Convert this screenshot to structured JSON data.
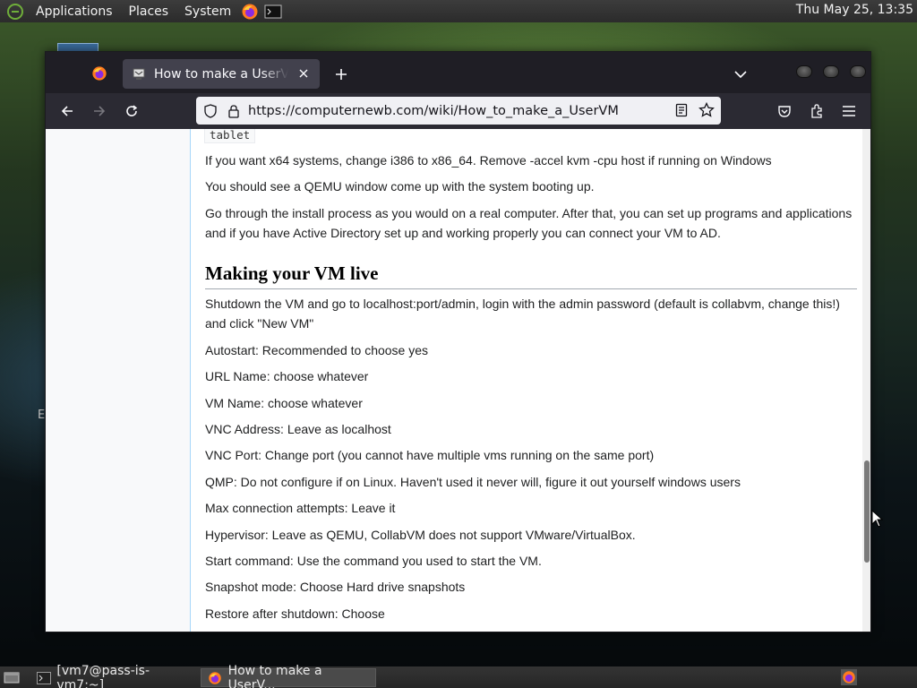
{
  "top_panel": {
    "menus": [
      "Applications",
      "Places",
      "System"
    ],
    "clock": "Thu May 25, 13:35"
  },
  "desktop": {
    "partial_label": "E"
  },
  "browser": {
    "tab": {
      "title": "How to make a UserVM - CollabVM Wiki"
    },
    "url": "https://computernewb.com/wiki/How_to_make_a_UserVM"
  },
  "page": {
    "code_fragment": "tablet",
    "paragraphs_top": [
      "If you want x64 systems, change i386 to x86_64. Remove -accel kvm -cpu host if running on Windows",
      "You should see a QEMU window come up with the system booting up.",
      "Go through the install process as you would on a real computer. After that, you can set up programs and applications and if you have Active Directory set up and working properly you can connect your VM to AD."
    ],
    "section_heading": "Making your VM live",
    "paragraphs_section": [
      "Shutdown the VM and go to localhost:port/admin, login with the admin password (default is collabvm, change this!) and click \"New VM\"",
      "Autostart: Recommended to choose yes",
      "URL Name: choose whatever",
      "VM Name: choose whatever",
      "VNC Address: Leave as localhost",
      "VNC Port: Change port (you cannot have multiple vms running on the same port)",
      "QMP: Do not configure if on Linux. Haven't used it never will, figure it out yourself windows users",
      "Max connection attempts: Leave it",
      "Hypervisor: Leave as QEMU, CollabVM does not support VMware/VirtualBox.",
      "Start command: Use the command you used to start the VM.",
      "Snapshot mode: Choose Hard drive snapshots",
      "Restore after shutdown: Choose"
    ]
  },
  "taskbar": {
    "tasks": [
      "[vm7@pass-is-vm7:~]",
      "How to make a UserV..."
    ]
  },
  "colors": {
    "link_blue": "#0645ad",
    "panel_bg": "#2b2b2b",
    "browser_chrome": "#2b2a33"
  }
}
